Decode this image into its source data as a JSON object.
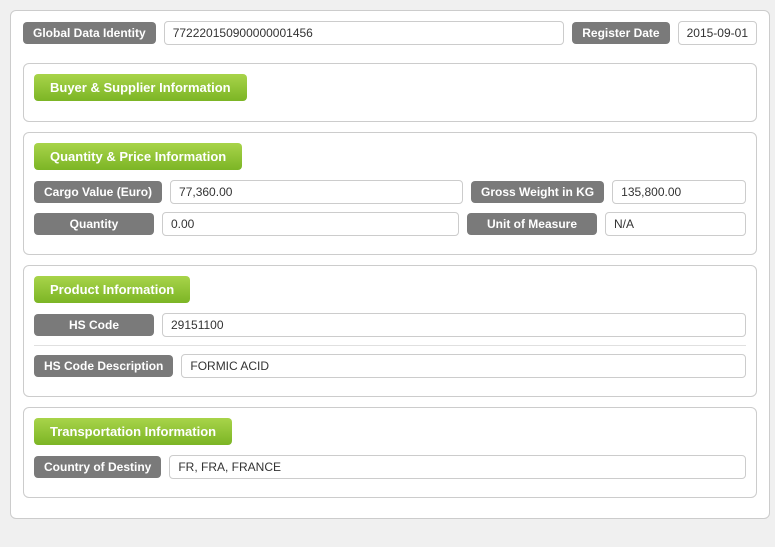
{
  "header": {
    "global_data_identity_label": "Global Data Identity",
    "global_data_identity_value": "772220150900000001456",
    "register_date_label": "Register Date",
    "register_date_value": "2015-09-01"
  },
  "sections": {
    "buyer_supplier": {
      "title": "Buyer & Supplier Information"
    },
    "quantity_price": {
      "title": "Quantity & Price Information",
      "fields": [
        {
          "left_label": "Cargo Value (Euro)",
          "left_value": "77,360.00",
          "right_label": "Gross Weight in KG",
          "right_value": "135,800.00"
        },
        {
          "left_label": "Quantity",
          "left_value": "0.00",
          "right_label": "Unit of Measure",
          "right_value": "N/A"
        }
      ]
    },
    "product_information": {
      "title": "Product Information",
      "fields": [
        {
          "label": "HS Code",
          "value": "29151100"
        },
        {
          "label": "HS Code Description",
          "value": "FORMIC ACID"
        }
      ]
    },
    "transportation_information": {
      "title": "Transportation Information",
      "fields": [
        {
          "label": "Country of Destiny",
          "value": "FR, FRA, FRANCE"
        }
      ]
    }
  }
}
